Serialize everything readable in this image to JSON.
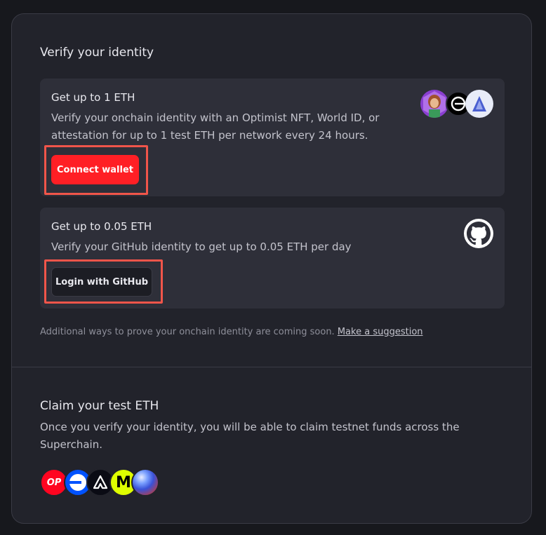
{
  "verify": {
    "title": "Verify your identity",
    "onchain": {
      "title": "Get up to 1 ETH",
      "description": "Verify your onchain identity with an Optimist NFT, World ID, or attestation for up to 1 test ETH per network every 24 hours.",
      "button_label": "Connect wallet",
      "icons": [
        "optimist-nft-avatar-icon",
        "worldcoin-icon",
        "attestation-icon"
      ]
    },
    "github": {
      "title": "Get up to 0.05 ETH",
      "description": "Verify your GitHub identity to get up to 0.05 ETH per day",
      "button_label": "Login with GitHub",
      "icon": "github-icon"
    },
    "note": {
      "text": "Additional ways to prove your onchain identity are coming soon.",
      "link": "Make a suggestion"
    }
  },
  "claim": {
    "title": "Claim your test ETH",
    "description": "Once you verify your identity, you will be able to claim testnet funds across the Superchain.",
    "chain_icons": [
      "op-icon",
      "base-icon",
      "lisk-icon",
      "mode-icon",
      "zora-icon"
    ],
    "op_text": "OP",
    "mode_text": "M"
  },
  "colors": {
    "accent_red": "#ff1f25",
    "highlight": "#f0554a",
    "mode_yellow": "#dffe00",
    "base_blue": "#0052ff"
  }
}
